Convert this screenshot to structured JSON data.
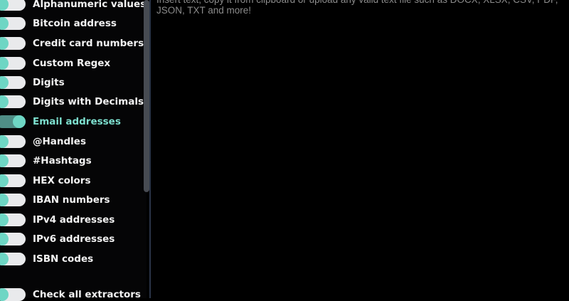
{
  "extractors": [
    {
      "label": "Alphanumeric values",
      "enabled": false
    },
    {
      "label": "Bitcoin address",
      "enabled": false
    },
    {
      "label": "Credit card numbers",
      "enabled": false
    },
    {
      "label": "Custom Regex",
      "enabled": false
    },
    {
      "label": "Digits",
      "enabled": false
    },
    {
      "label": "Digits with Decimals",
      "enabled": false
    },
    {
      "label": "Email addresses",
      "enabled": true
    },
    {
      "label": "@Handles",
      "enabled": false
    },
    {
      "label": "#Hashtags",
      "enabled": false
    },
    {
      "label": "HEX colors",
      "enabled": false
    },
    {
      "label": "IBAN numbers",
      "enabled": false
    },
    {
      "label": "IPv4 addresses",
      "enabled": false
    },
    {
      "label": "IPv6 addresses",
      "enabled": false
    },
    {
      "label": "ISBN codes",
      "enabled": false
    }
  ],
  "check_all": {
    "label": "Check all extractors",
    "enabled": false
  },
  "input": {
    "placeholder": "Insert text, copy it from clipboard or upload any valid text file such as DOCX, XLSX, CSV, PDF, JSON, TXT and more!"
  },
  "colors": {
    "background": "#000000",
    "accent": "#7de0cf",
    "toggle_knob": "#6ed6c4",
    "toggle_off_track": "#e9eaec",
    "toggle_on_track": "#4f8e86",
    "placeholder_text": "#8b8b8b"
  }
}
